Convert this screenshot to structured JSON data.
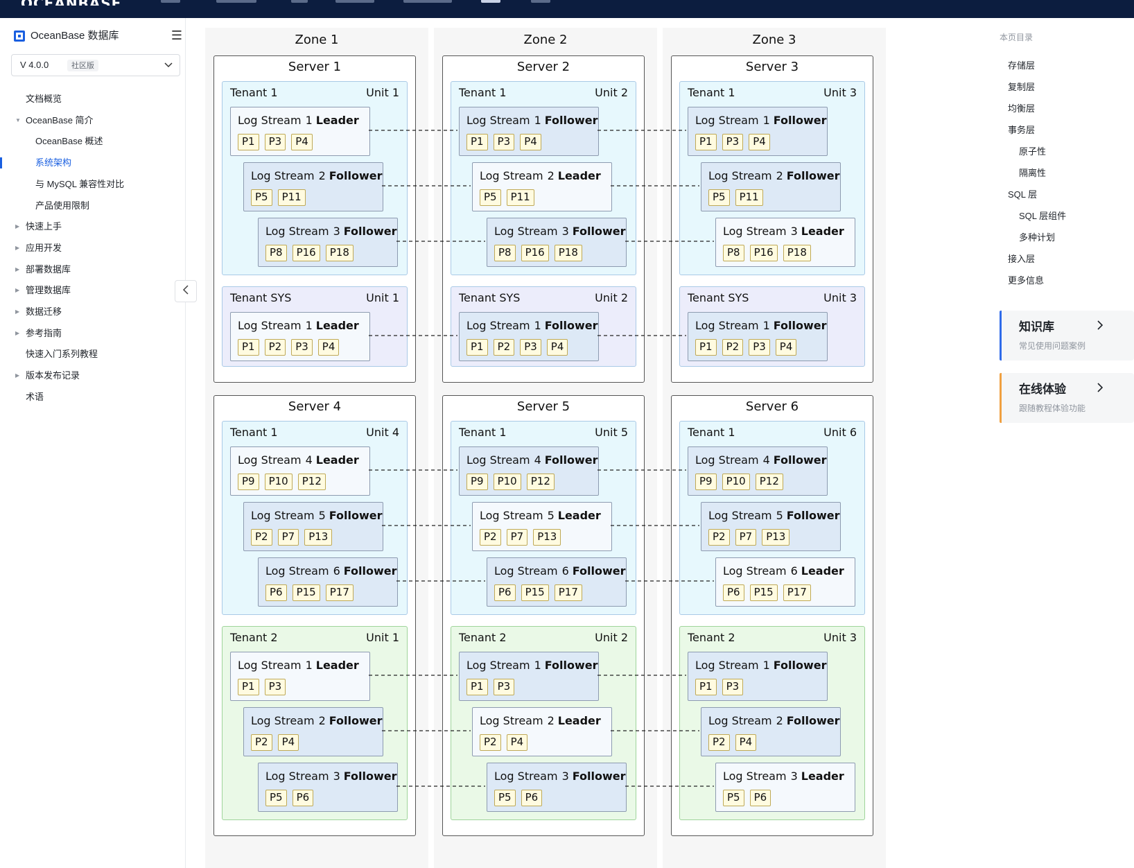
{
  "topnav": {
    "logo": "OCEANBASE"
  },
  "sidebar": {
    "title": "OceanBase 数据库",
    "menu_icon": "hamburger-icon",
    "version": "V 4.0.0",
    "version_badge": "社区版",
    "items": [
      {
        "label": "文档概览",
        "expandable": false,
        "level": 1
      },
      {
        "label": "OceanBase 简介",
        "expandable": true,
        "expanded": true,
        "level": 1
      },
      {
        "label": "OceanBase 概述",
        "expandable": false,
        "level": 2
      },
      {
        "label": "系统架构",
        "expandable": false,
        "level": 2,
        "active": true
      },
      {
        "label": "与 MySQL 兼容性对比",
        "expandable": false,
        "level": 2
      },
      {
        "label": "产品使用限制",
        "expandable": false,
        "level": 2
      },
      {
        "label": "快速上手",
        "expandable": true,
        "level": 1
      },
      {
        "label": "应用开发",
        "expandable": true,
        "level": 1
      },
      {
        "label": "部署数据库",
        "expandable": true,
        "level": 1
      },
      {
        "label": "管理数据库",
        "expandable": true,
        "level": 1
      },
      {
        "label": "数据迁移",
        "expandable": true,
        "level": 1
      },
      {
        "label": "参考指南",
        "expandable": true,
        "level": 1
      },
      {
        "label": "快速入门系列教程",
        "expandable": false,
        "level": 1
      },
      {
        "label": "版本发布记录",
        "expandable": true,
        "level": 1
      },
      {
        "label": "术语",
        "expandable": false,
        "level": 1
      }
    ]
  },
  "toc": {
    "title": "本页目录",
    "items": [
      {
        "label": "存储层",
        "level": 1
      },
      {
        "label": "复制层",
        "level": 1
      },
      {
        "label": "均衡层",
        "level": 1
      },
      {
        "label": "事务层",
        "level": 1
      },
      {
        "label": "原子性",
        "level": 2
      },
      {
        "label": "隔离性",
        "level": 2
      },
      {
        "label": "SQL 层",
        "level": 1
      },
      {
        "label": "SQL 层组件",
        "level": 2
      },
      {
        "label": "多种计划",
        "level": 2
      },
      {
        "label": "接入层",
        "level": 1
      },
      {
        "label": "更多信息",
        "level": 1
      }
    ]
  },
  "cards": [
    {
      "title": "知识库",
      "subtitle": "常见使用问题案例",
      "color": "#2f6bea"
    },
    {
      "title": "在线体验",
      "subtitle": "跟随教程体验功能",
      "color": "#f0a040"
    }
  ],
  "colors": {
    "nav_bg": "#0c1d3f",
    "accent": "#1a5fe0",
    "tenant1_bg": "#e7f8fd",
    "tenant_sys_bg": "#ecedfb",
    "tenant2_bg": "#eaf9e7",
    "chip_bg": "#fffbe0"
  },
  "diagram": {
    "zones": [
      "Zone 1",
      "Zone 2",
      "Zone 3"
    ],
    "role_prefix": "Log Stream",
    "servers": [
      {
        "title": "Server 1",
        "tenants": [
          {
            "name": "Tenant 1",
            "unit": "Unit 1",
            "type": "t1",
            "streams": [
              {
                "id": 1,
                "role": "Leader",
                "parts": [
                  "P1",
                  "P3",
                  "P4"
                ]
              },
              {
                "id": 2,
                "role": "Follower",
                "parts": [
                  "P5",
                  "P11"
                ]
              },
              {
                "id": 3,
                "role": "Follower",
                "parts": [
                  "P8",
                  "P16",
                  "P18"
                ]
              }
            ]
          },
          {
            "name": "Tenant SYS",
            "unit": "Unit 1",
            "type": "tsys",
            "streams": [
              {
                "id": 1,
                "role": "Leader",
                "parts": [
                  "P1",
                  "P2",
                  "P3",
                  "P4"
                ]
              }
            ]
          }
        ]
      },
      {
        "title": "Server 2",
        "tenants": [
          {
            "name": "Tenant 1",
            "unit": "Unit 2",
            "type": "t1",
            "streams": [
              {
                "id": 1,
                "role": "Follower",
                "parts": [
                  "P1",
                  "P3",
                  "P4"
                ]
              },
              {
                "id": 2,
                "role": "Leader",
                "parts": [
                  "P5",
                  "P11"
                ]
              },
              {
                "id": 3,
                "role": "Follower",
                "parts": [
                  "P8",
                  "P16",
                  "P18"
                ]
              }
            ]
          },
          {
            "name": "Tenant SYS",
            "unit": "Unit 2",
            "type": "tsys",
            "streams": [
              {
                "id": 1,
                "role": "Follower",
                "parts": [
                  "P1",
                  "P2",
                  "P3",
                  "P4"
                ]
              }
            ]
          }
        ]
      },
      {
        "title": "Server 3",
        "tenants": [
          {
            "name": "Tenant 1",
            "unit": "Unit 3",
            "type": "t1",
            "streams": [
              {
                "id": 1,
                "role": "Follower",
                "parts": [
                  "P1",
                  "P3",
                  "P4"
                ]
              },
              {
                "id": 2,
                "role": "Follower",
                "parts": [
                  "P5",
                  "P11"
                ]
              },
              {
                "id": 3,
                "role": "Leader",
                "parts": [
                  "P8",
                  "P16",
                  "P18"
                ]
              }
            ]
          },
          {
            "name": "Tenant SYS",
            "unit": "Unit 3",
            "type": "tsys",
            "streams": [
              {
                "id": 1,
                "role": "Follower",
                "parts": [
                  "P1",
                  "P2",
                  "P3",
                  "P4"
                ]
              }
            ]
          }
        ]
      },
      {
        "title": "Server 4",
        "tenants": [
          {
            "name": "Tenant 1",
            "unit": "Unit 4",
            "type": "t1",
            "streams": [
              {
                "id": 4,
                "role": "Leader",
                "parts": [
                  "P9",
                  "P10",
                  "P12"
                ]
              },
              {
                "id": 5,
                "role": "Follower",
                "parts": [
                  "P2",
                  "P7",
                  "P13"
                ]
              },
              {
                "id": 6,
                "role": "Follower",
                "parts": [
                  "P6",
                  "P15",
                  "P17"
                ]
              }
            ]
          },
          {
            "name": "Tenant 2",
            "unit": "Unit 1",
            "type": "t2",
            "streams": [
              {
                "id": 1,
                "role": "Leader",
                "parts": [
                  "P1",
                  "P3"
                ]
              },
              {
                "id": 2,
                "role": "Follower",
                "parts": [
                  "P2",
                  "P4"
                ]
              },
              {
                "id": 3,
                "role": "Follower",
                "parts": [
                  "P5",
                  "P6"
                ]
              }
            ]
          }
        ]
      },
      {
        "title": "Server 5",
        "tenants": [
          {
            "name": "Tenant 1",
            "unit": "Unit 5",
            "type": "t1",
            "streams": [
              {
                "id": 4,
                "role": "Follower",
                "parts": [
                  "P9",
                  "P10",
                  "P12"
                ]
              },
              {
                "id": 5,
                "role": "Leader",
                "parts": [
                  "P2",
                  "P7",
                  "P13"
                ]
              },
              {
                "id": 6,
                "role": "Follower",
                "parts": [
                  "P6",
                  "P15",
                  "P17"
                ]
              }
            ]
          },
          {
            "name": "Tenant 2",
            "unit": "Unit 2",
            "type": "t2",
            "streams": [
              {
                "id": 1,
                "role": "Follower",
                "parts": [
                  "P1",
                  "P3"
                ]
              },
              {
                "id": 2,
                "role": "Leader",
                "parts": [
                  "P2",
                  "P4"
                ]
              },
              {
                "id": 3,
                "role": "Follower",
                "parts": [
                  "P5",
                  "P6"
                ]
              }
            ]
          }
        ]
      },
      {
        "title": "Server 6",
        "tenants": [
          {
            "name": "Tenant 1",
            "unit": "Unit 6",
            "type": "t1",
            "streams": [
              {
                "id": 4,
                "role": "Follower",
                "parts": [
                  "P9",
                  "P10",
                  "P12"
                ]
              },
              {
                "id": 5,
                "role": "Follower",
                "parts": [
                  "P2",
                  "P7",
                  "P13"
                ]
              },
              {
                "id": 6,
                "role": "Leader",
                "parts": [
                  "P6",
                  "P15",
                  "P17"
                ]
              }
            ]
          },
          {
            "name": "Tenant 2",
            "unit": "Unit 3",
            "type": "t2",
            "streams": [
              {
                "id": 1,
                "role": "Follower",
                "parts": [
                  "P1",
                  "P3"
                ]
              },
              {
                "id": 2,
                "role": "Follower",
                "parts": [
                  "P2",
                  "P4"
                ]
              },
              {
                "id": 3,
                "role": "Leader",
                "parts": [
                  "P5",
                  "P6"
                ]
              }
            ]
          }
        ]
      }
    ]
  }
}
